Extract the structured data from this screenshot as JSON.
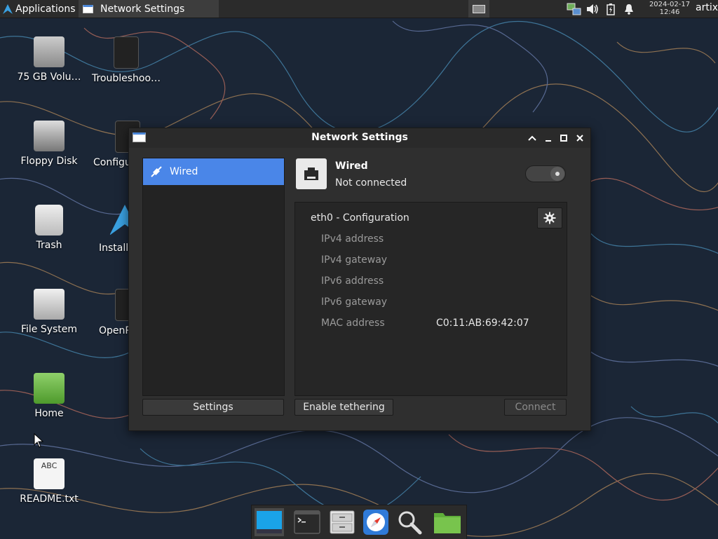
{
  "panel": {
    "applications_label": "Applications",
    "task_label": "Network Settings",
    "clock_date": "2024-02-17",
    "clock_time": "12:46",
    "user": "artix"
  },
  "desktop": {
    "icons": [
      {
        "label": "75 GB Volu…"
      },
      {
        "label": "Troubleshoo…"
      },
      {
        "label": "Floppy Disk"
      },
      {
        "label": "Configu"
      },
      {
        "label": "Trash"
      },
      {
        "label": "Install"
      },
      {
        "label": "File System"
      },
      {
        "label": "OpenR"
      },
      {
        "label": "Home"
      },
      {
        "label": "README.txt"
      }
    ],
    "readme_icon_text": "ABC"
  },
  "window": {
    "title": "Network Settings",
    "sidebar": {
      "items": [
        {
          "label": "Wired",
          "selected": true
        }
      ]
    },
    "device": {
      "name": "Wired",
      "status": "Not connected",
      "enabled": false
    },
    "config": {
      "title": "eth0 - Configuration",
      "rows": [
        {
          "label": "IPv4 address",
          "value": ""
        },
        {
          "label": "IPv4 gateway",
          "value": ""
        },
        {
          "label": "IPv6 address",
          "value": ""
        },
        {
          "label": "IPv6 gateway",
          "value": ""
        },
        {
          "label": "MAC address",
          "value": "C0:11:AB:69:42:07"
        }
      ]
    },
    "buttons": {
      "settings": "Settings",
      "tethering": "Enable tethering",
      "connect": "Connect"
    }
  },
  "colors": {
    "accent": "#4a86e8",
    "window_bg": "#2f2f2f",
    "panel_bg": "#2b2b2b",
    "wallpaper_bg": "#1b2636"
  }
}
